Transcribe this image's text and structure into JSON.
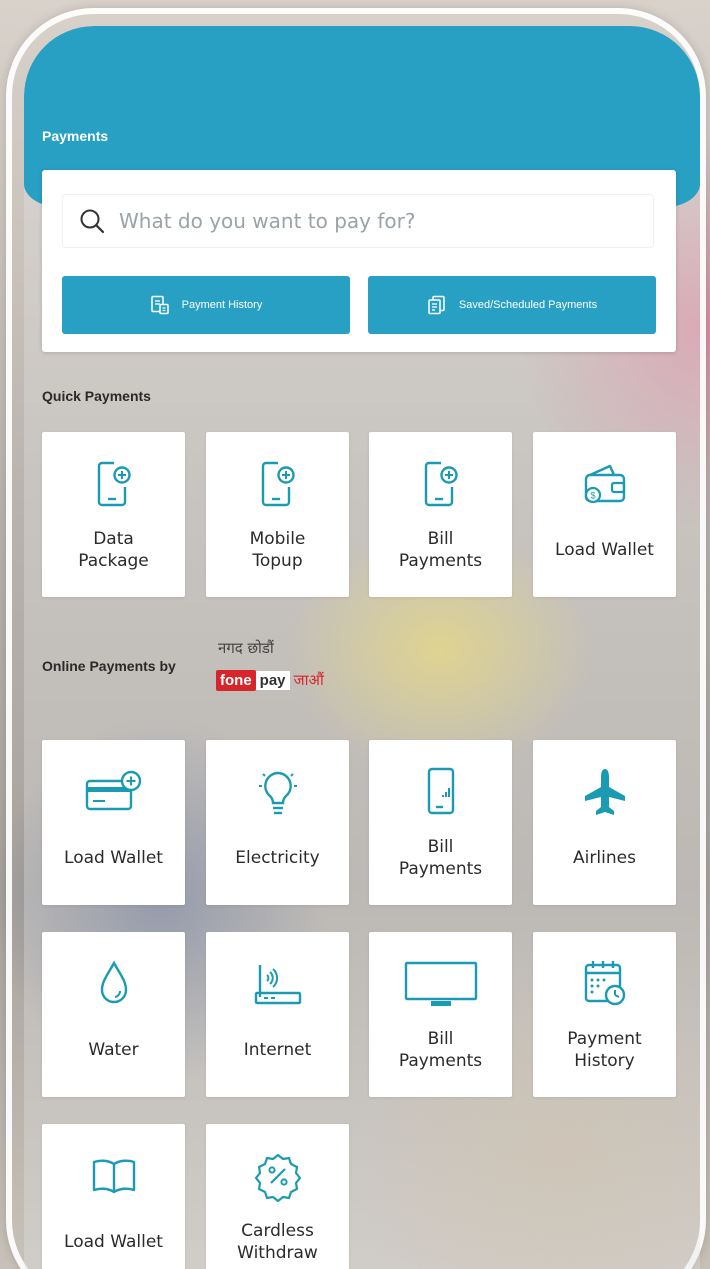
{
  "header": {
    "title": "Payments"
  },
  "search": {
    "placeholder": "What do you want to pay for?"
  },
  "actions": {
    "payment_history": "Payment History",
    "saved_scheduled": "Saved/Scheduled Payments"
  },
  "quick_payments": {
    "title": "Quick Payments",
    "items": [
      {
        "label": "Data\nPackage",
        "icon": "mobile-add-icon"
      },
      {
        "label": "Mobile\nTopup",
        "icon": "mobile-add-icon"
      },
      {
        "label": "Bill\nPayments",
        "icon": "mobile-add-icon"
      },
      {
        "label": "Load Wallet",
        "icon": "wallet-icon"
      }
    ]
  },
  "online_payments": {
    "title": "Online Payments by",
    "brand": {
      "top_text": "नगद छोडौं",
      "fone": "fone",
      "pay": "pay",
      "bottom_text": "जाऔं"
    },
    "items": [
      {
        "label": "Load Wallet",
        "icon": "card-add-icon"
      },
      {
        "label": "Electricity",
        "icon": "bulb-icon"
      },
      {
        "label": "Bill\nPayments",
        "icon": "mobile-signal-icon"
      },
      {
        "label": "Airlines",
        "icon": "airplane-icon"
      },
      {
        "label": "Water",
        "icon": "water-drop-icon"
      },
      {
        "label": "Internet",
        "icon": "router-icon"
      },
      {
        "label": "Bill\nPayments",
        "icon": "tv-icon"
      },
      {
        "label": "Payment\nHistory",
        "icon": "calendar-clock-icon"
      },
      {
        "label": "Load Wallet",
        "icon": "book-icon"
      },
      {
        "label": "Cardless\nWithdraw",
        "icon": "discount-badge-icon"
      }
    ]
  },
  "colors": {
    "primary": "#27a0c4",
    "icon": "#1b9bb3",
    "brand_red": "#d7262b"
  }
}
